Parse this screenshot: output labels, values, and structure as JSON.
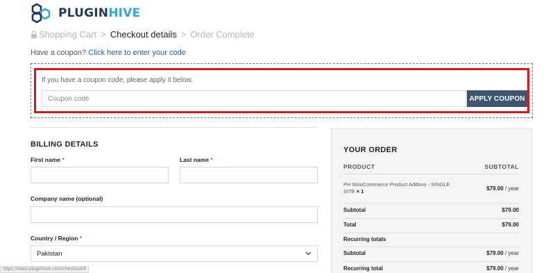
{
  "brand": {
    "name_part1": "PLUGIN",
    "name_part2": "HIVE"
  },
  "breadcrumb": {
    "step1": "Shopping Cart",
    "sep": ">",
    "step2": "Checkout details",
    "step3": "Order Complete"
  },
  "coupon": {
    "question": "Have a coupon?",
    "link": "Click here to enter your code",
    "hint": "If you have a coupon code, please apply it below.",
    "placeholder": "Coupon code",
    "apply_label": "APPLY COUPON"
  },
  "billing": {
    "title": "BILLING DETAILS",
    "first_name_label": "First name",
    "last_name_label": "Last name",
    "company_label": "Company name (optional)",
    "country_label": "Country / Region",
    "country_value": "Pakistan",
    "required_mark": "*"
  },
  "order": {
    "title": "YOUR ORDER",
    "col_product": "PRODUCT",
    "col_subtotal": "SUBTOTAL",
    "product_name": "PH WooCommerce Product Addons - SINGLE SITE",
    "product_qty": "× 1",
    "product_price": "$79.00",
    "per_year": "/ year",
    "subtotal_label": "Subtotal",
    "subtotal_value": "$79.00",
    "total_label": "Total",
    "total_value": "$79.00",
    "recurring_label": "Recurring totals",
    "recurring_subtotal_label": "Subtotal",
    "recurring_subtotal_value": "$79.00",
    "recurring_total_label": "Recurring total",
    "recurring_total_value": "$79.00"
  },
  "status_bar": {
    "url": "https://www.pluginhive.com/checkout/#"
  },
  "colors": {
    "brand_dark": "#1f3a5f",
    "brand_light": "#3aa5dc",
    "button": "#3e5570",
    "highlight": "#e0151b",
    "link": "#2a5ea8"
  }
}
